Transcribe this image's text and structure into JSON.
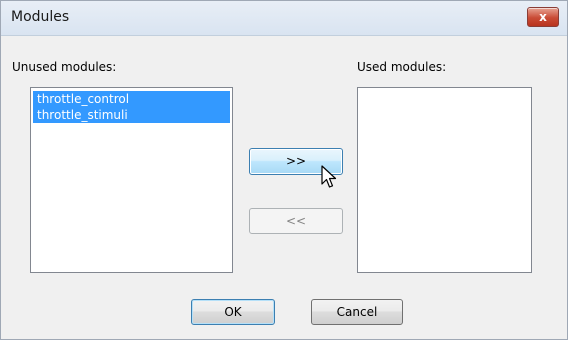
{
  "window": {
    "title": "Modules",
    "close_label": "x"
  },
  "unused": {
    "label": "Unused modules:",
    "items": [
      "throttle_control",
      "throttle_stimuli"
    ]
  },
  "used": {
    "label": "Used modules:",
    "items": []
  },
  "buttons": {
    "add": ">>",
    "remove": "<<",
    "ok": "OK",
    "cancel": "Cancel"
  },
  "colors": {
    "selection": "#3399ff"
  }
}
